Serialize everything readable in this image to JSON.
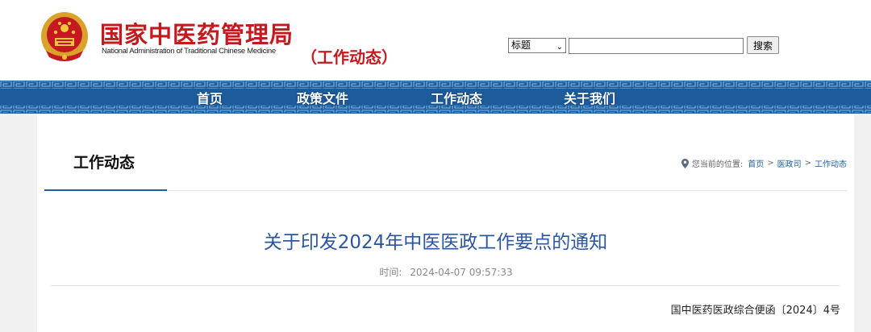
{
  "header": {
    "brand_cn": "国家中医药管理局",
    "brand_en": "National Administration of Traditional Chinese Medicine",
    "section_tag": "（工作动态）"
  },
  "search": {
    "field_selected": "标题",
    "query_value": "",
    "button_label": "搜索"
  },
  "nav": {
    "items": [
      {
        "label": "首页"
      },
      {
        "label": "政策文件"
      },
      {
        "label": "工作动态"
      },
      {
        "label": "关于我们"
      }
    ]
  },
  "section": {
    "title": "工作动态"
  },
  "breadcrumb": {
    "prefix": "您当前的位置:",
    "items": [
      {
        "label": "首页"
      },
      {
        "label": "医政司"
      },
      {
        "label": "工作动态"
      }
    ],
    "separator": ">"
  },
  "article": {
    "title": "关于印发2024年中医医政工作要点的通知",
    "time_label": "时间:",
    "time_value": "2024-04-07 09:57:33",
    "doc_number": "国中医药医政综合便函〔2024〕4号"
  },
  "colors": {
    "brand_red": "#c4191f",
    "nav_blue": "#1e5f9f",
    "title_blue": "#2b56a0"
  }
}
